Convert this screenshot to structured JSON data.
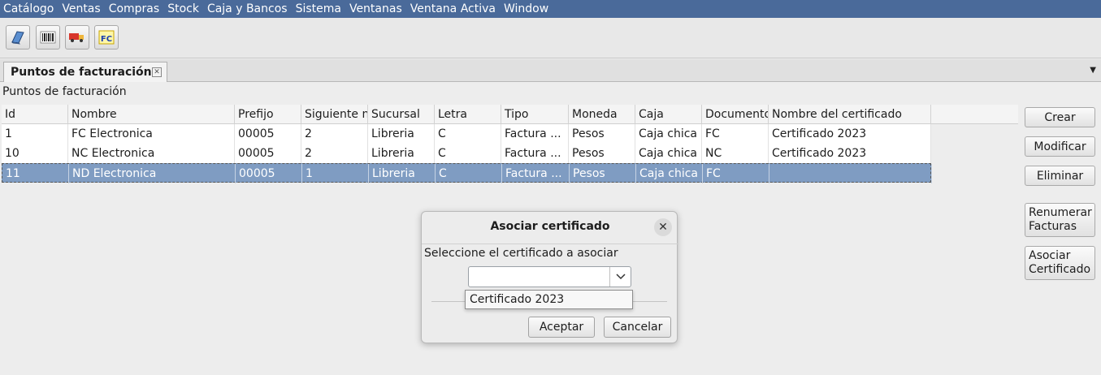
{
  "menu": [
    "Catálogo",
    "Ventas",
    "Compras",
    "Stock",
    "Caja y Bancos",
    "Sistema",
    "Ventanas",
    "Ventana Activa",
    "Window"
  ],
  "toolbar": {
    "buttons": [
      {
        "icon": "book-icon"
      },
      {
        "icon": "barcode-icon"
      },
      {
        "icon": "truck-icon"
      },
      {
        "icon": "fc-icon",
        "text": "FC"
      }
    ]
  },
  "tab": {
    "label": "Puntos de facturación",
    "close": "✕",
    "menu": "▼"
  },
  "section_title": "Puntos de facturación",
  "table": {
    "columns": [
      "Id",
      "Nombre",
      "Prefijo",
      "Siguiente n",
      "Sucursal",
      "Letra",
      "Tipo",
      "Moneda",
      "Caja",
      "Documento",
      "Nombre del certificado"
    ],
    "rows": [
      [
        "1",
        "FC Electronica",
        "00005",
        "2",
        "Libreria",
        "C",
        "Factura ...",
        "Pesos",
        "Caja chica",
        "FC",
        "Certificado 2023"
      ],
      [
        "10",
        "NC Electronica",
        "00005",
        "2",
        "Libreria",
        "C",
        "Factura ...",
        "Pesos",
        "Caja chica",
        "NC",
        "Certificado 2023"
      ],
      [
        "11",
        "ND Electronica",
        "00005",
        "1",
        "Libreria",
        "C",
        "Factura ...",
        "Pesos",
        "Caja chica",
        "FC",
        ""
      ]
    ],
    "selected_row": 2
  },
  "actions": {
    "crear": "Crear",
    "modificar": "Modificar",
    "eliminar": "Eliminar",
    "renumerar_1": "Renumerar",
    "renumerar_2": "Facturas",
    "asociar_1": "Asociar",
    "asociar_2": "Certificado"
  },
  "dialog": {
    "title": "Asociar certificado",
    "close": "✕",
    "prompt": "Seleccione el certificado a asociar",
    "combo_value": "",
    "dropdown_option": "Certificado 2023",
    "accept": "Aceptar",
    "cancel": "Cancelar"
  },
  "colors": {
    "menubar": "#4a6a9a",
    "selection": "#7f9cc2"
  }
}
